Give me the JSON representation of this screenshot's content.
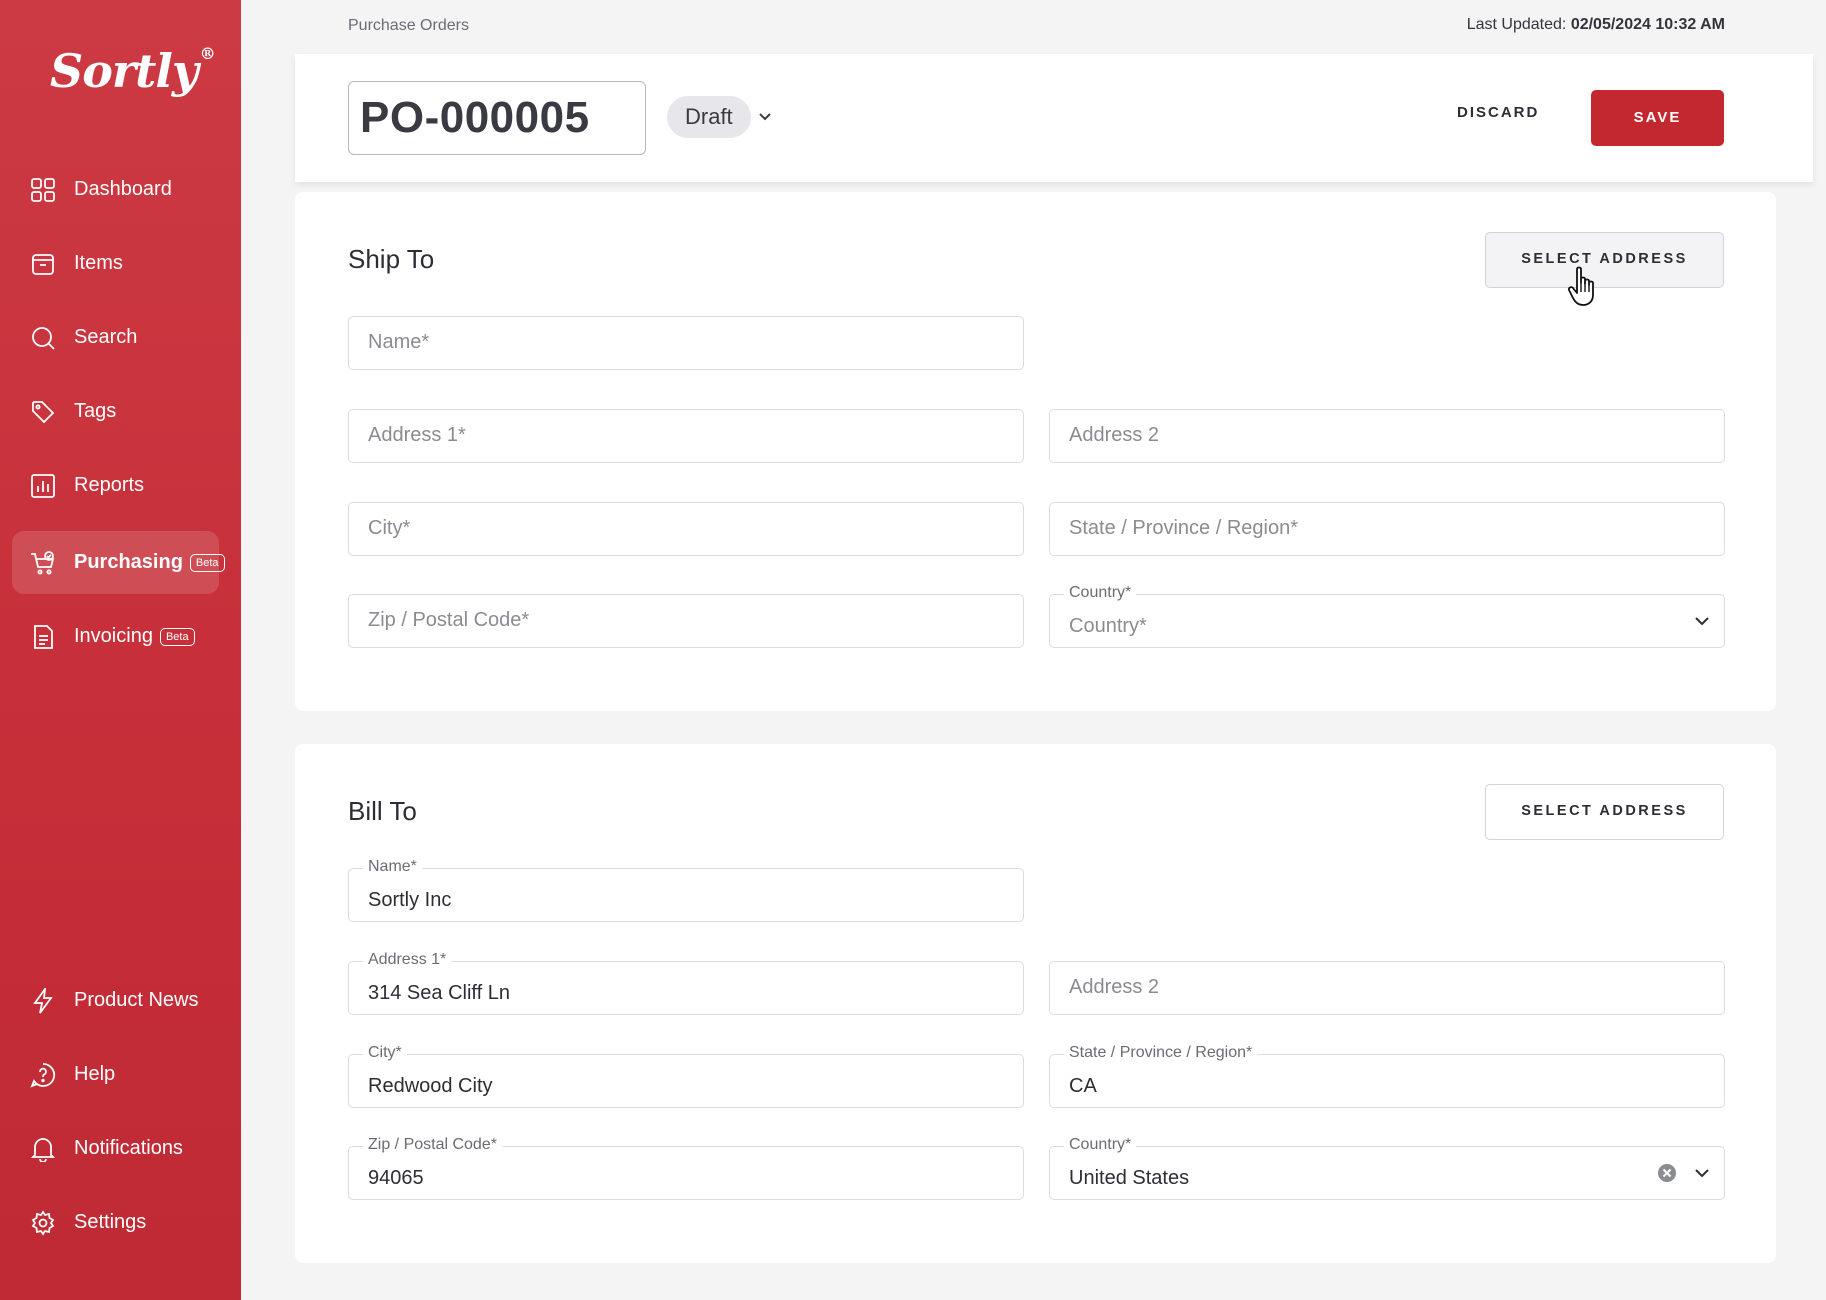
{
  "sidebar": {
    "logo": "Sortly",
    "logo_mark": "®",
    "nav": [
      {
        "label": "Dashboard",
        "icon": "dashboard-icon"
      },
      {
        "label": "Items",
        "icon": "items-icon"
      },
      {
        "label": "Search",
        "icon": "search-icon"
      },
      {
        "label": "Tags",
        "icon": "tag-icon"
      },
      {
        "label": "Reports",
        "icon": "reports-icon"
      },
      {
        "label": "Purchasing",
        "icon": "cart-icon",
        "badge": "Beta",
        "active": true
      },
      {
        "label": "Invoicing",
        "icon": "invoice-icon",
        "badge": "Beta"
      }
    ],
    "bottom_nav": [
      {
        "label": "Product News",
        "icon": "lightning-icon"
      },
      {
        "label": "Help",
        "icon": "help-icon"
      },
      {
        "label": "Notifications",
        "icon": "bell-icon"
      },
      {
        "label": "Settings",
        "icon": "gear-icon"
      }
    ]
  },
  "header": {
    "breadcrumb": "Purchase Orders",
    "last_updated_label": "Last Updated:",
    "last_updated_value": "02/05/2024 10:32 AM",
    "po_number": "PO-000005",
    "status": "Draft",
    "discard_label": "DISCARD",
    "save_label": "SAVE"
  },
  "ship_to": {
    "title": "Ship To",
    "select_address_label": "SELECT ADDRESS",
    "name_placeholder": "Name*",
    "address1_placeholder": "Address 1*",
    "address2_placeholder": "Address 2",
    "city_placeholder": "City*",
    "state_placeholder": "State / Province / Region*",
    "zip_placeholder": "Zip / Postal Code*",
    "country_label": "Country*",
    "country_placeholder": "Country*"
  },
  "bill_to": {
    "title": "Bill To",
    "select_address_label": "SELECT ADDRESS",
    "name_label": "Name*",
    "name_value": "Sortly Inc",
    "address1_label": "Address 1*",
    "address1_value": "314 Sea Cliff Ln",
    "address2_placeholder": "Address 2",
    "city_label": "City*",
    "city_value": "Redwood City",
    "state_label": "State / Province / Region*",
    "state_value": "CA",
    "zip_label": "Zip / Postal Code*",
    "zip_value": "94065",
    "country_label": "Country*",
    "country_value": "United States"
  },
  "colors": {
    "brand_red": "#c4282f",
    "sidebar_red": "#c62e38"
  }
}
